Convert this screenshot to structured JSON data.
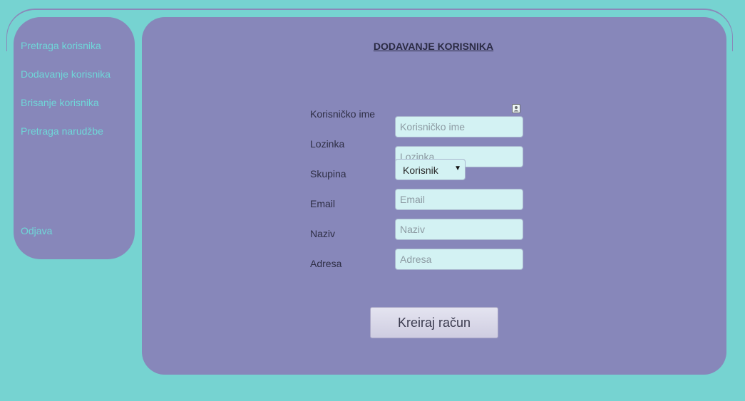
{
  "sidebar": {
    "links": [
      {
        "label": "Pretraga korisnika"
      },
      {
        "label": "Dodavanje korisnika"
      },
      {
        "label": "Brisanje korisnika"
      },
      {
        "label": "Pretraga narudžbe"
      }
    ],
    "logout_label": "Odjava"
  },
  "main": {
    "title": "DODAVANJE KORISNIKA",
    "form": {
      "username": {
        "label": "Korisničko ime",
        "placeholder": "Korisničko ime",
        "value": ""
      },
      "password": {
        "label": "Lozinka",
        "placeholder": "Lozinka",
        "value": ""
      },
      "group": {
        "label": "Skupina",
        "selected": "Korisnik"
      },
      "email": {
        "label": "Email",
        "placeholder": "Email",
        "value": ""
      },
      "name": {
        "label": "Naziv",
        "placeholder": "Naziv",
        "value": ""
      },
      "address": {
        "label": "Adresa",
        "placeholder": "Adresa",
        "value": ""
      },
      "submit_label": "Kreiraj račun"
    }
  },
  "icons": {
    "username_field_icon": "contact-card-icon",
    "select_arrow": "dropdown-arrow-icon"
  },
  "colors": {
    "background": "#76d3d1",
    "panel": "#8787ba",
    "link": "#6fd7d8",
    "input_background": "#d3f2f3"
  }
}
